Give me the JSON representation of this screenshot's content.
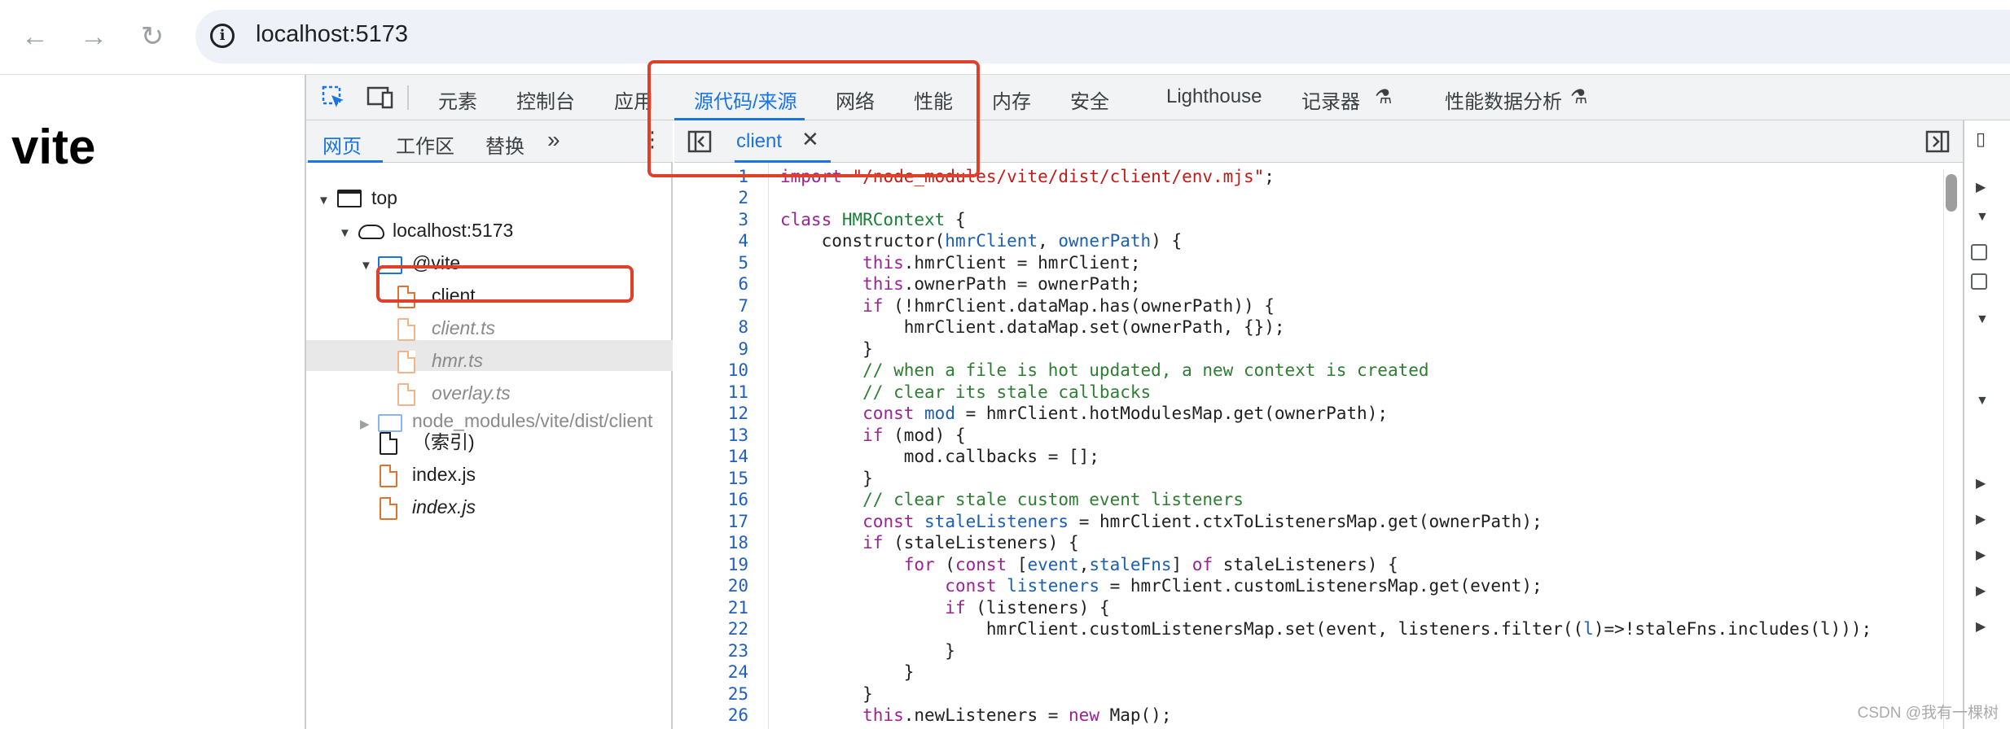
{
  "browser": {
    "url": "localhost:5173",
    "back_icon": "arrow-left",
    "forward_icon": "arrow-right",
    "reload_icon": "reload"
  },
  "page": {
    "heading": "vite"
  },
  "devtools": {
    "tabs": [
      "元素",
      "控制台",
      "应用",
      "源代码/来源",
      "网络",
      "性能",
      "内存",
      "安全",
      "Lighthouse",
      "记录器",
      "性能数据分析"
    ],
    "active_tab": "源代码/来源",
    "sources": {
      "subtabs": [
        "网页",
        "工作区",
        "替换"
      ],
      "tree": {
        "top": "top",
        "host": "localhost:5173",
        "folder": "@vite",
        "files": [
          "client",
          "client.ts",
          "hmr.ts",
          "overlay.ts"
        ],
        "node_modules": "node_modules/vite/dist/client",
        "index_label": "（索引)",
        "index_js": "index.js",
        "index_js_italic": "index.js"
      },
      "editor_tab": "client",
      "line_numbers": [
        "1",
        "2",
        "3",
        "4",
        "5",
        "6",
        "7",
        "8",
        "9",
        "10",
        "11",
        "12",
        "13",
        "14",
        "15",
        "16",
        "17",
        "18",
        "19",
        "20",
        "21",
        "22",
        "23",
        "24",
        "25",
        "26"
      ]
    }
  },
  "code": {
    "l1a": "import ",
    "l1b": "\"/node_modules/vite/dist/client/env.mjs\"",
    "l1c": ";",
    "l3a": "class ",
    "l3b": "HMRContext",
    "l3c": " {",
    "l4a": "    constructor(",
    "l4b": "hmrClient",
    "l4c": ", ",
    "l4d": "ownerPath",
    "l4e": ") {",
    "l5a": "        ",
    "l5b": "this",
    "l5c": ".hmrClient = hmrClient;",
    "l6a": "        ",
    "l6b": "this",
    "l6c": ".ownerPath = ownerPath;",
    "l7a": "        ",
    "l7b": "if",
    "l7c": " (!hmrClient.dataMap.has(ownerPath)) {",
    "l8": "            hmrClient.dataMap.set(ownerPath, {});",
    "l9": "        }",
    "l10": "        // when a file is hot updated, a new context is created",
    "l11": "        // clear its stale callbacks",
    "l12a": "        ",
    "l12b": "const",
    "l12c": " ",
    "l12d": "mod",
    "l12e": " = hmrClient.hotModulesMap.get(ownerPath);",
    "l13a": "        ",
    "l13b": "if",
    "l13c": " (mod) {",
    "l14": "            mod.callbacks = [];",
    "l15": "        }",
    "l16": "        // clear stale custom event listeners",
    "l17a": "        ",
    "l17b": "const",
    "l17c": " ",
    "l17d": "staleListeners",
    "l17e": " = hmrClient.ctxToListenersMap.get(ownerPath);",
    "l18a": "        ",
    "l18b": "if",
    "l18c": " (staleListeners) {",
    "l19a": "            ",
    "l19b": "for",
    "l19c": " (",
    "l19d": "const",
    "l19e": " [",
    "l19f": "event",
    "l19g": ",",
    "l19h": "staleFns",
    "l19i": "] ",
    "l19j": "of",
    "l19k": " staleListeners) {",
    "l20a": "                ",
    "l20b": "const",
    "l20c": " ",
    "l20d": "listeners",
    "l20e": " = hmrClient.customListenersMap.get(event);",
    "l21a": "                ",
    "l21b": "if",
    "l21c": " (listeners) {",
    "l22a": "                    hmrClient.customListenersMap.set(event, listeners.filter((",
    "l22b": "l",
    "l22c": ")=>!staleFns.includes(l)));",
    "l23": "                }",
    "l24": "            }",
    "l25": "        }",
    "l26a": "        ",
    "l26b": "this",
    "l26c": ".newListeners = ",
    "l26d": "new",
    "l26e": " Map();"
  },
  "watermark": "CSDN @我有一棵树",
  "colors": {
    "accent": "#1a73e8",
    "annotation": "#e0402a",
    "file_icon": "#e0742e"
  }
}
